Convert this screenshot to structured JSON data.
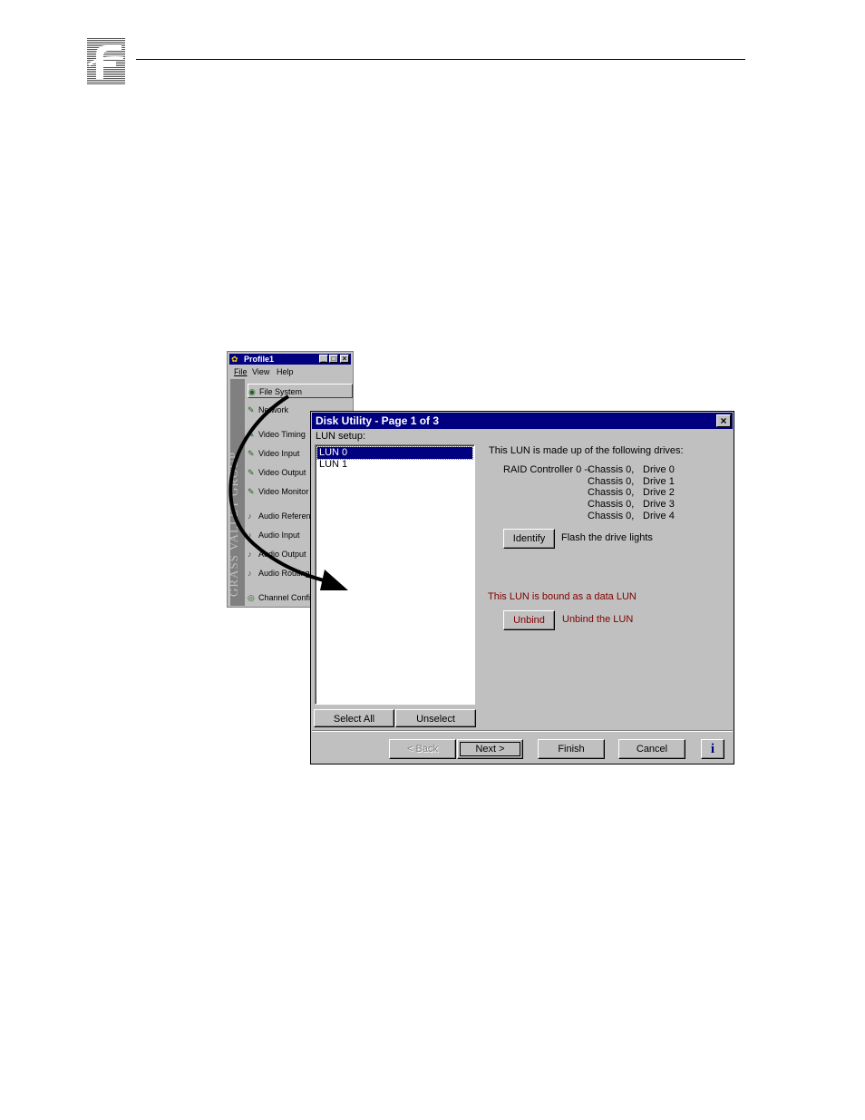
{
  "profile_window": {
    "title": "Profile1",
    "menu": [
      "File",
      "View",
      "Help"
    ],
    "sidebar_brand": "GRASS VALLEY GROUP",
    "nav_items": [
      "File System",
      "Network",
      "Video Timing",
      "Video Input",
      "Video Output",
      "Video Monitor",
      "Audio Reference",
      "Audio Input",
      "Audio Output",
      "Audio Routing",
      "Channel Config"
    ]
  },
  "dialog": {
    "title": "Disk Utility - Page 1 of 3",
    "lun_setup_label": "LUN setup:",
    "luns": [
      "LUN 0",
      "LUN 1"
    ],
    "select_all": "Select All",
    "unselect": "Unselect",
    "made_up_text": "This LUN is made up of the following drives:",
    "controller": "RAID Controller 0 --",
    "drives": [
      {
        "chassis": "Chassis 0,",
        "drive": "Drive 0"
      },
      {
        "chassis": "Chassis 0,",
        "drive": "Drive 1"
      },
      {
        "chassis": "Chassis 0,",
        "drive": "Drive 2"
      },
      {
        "chassis": "Chassis 0,",
        "drive": "Drive 3"
      },
      {
        "chassis": "Chassis 0,",
        "drive": "Drive 4"
      }
    ],
    "identify_label": "Identify",
    "identify_desc": "Flash the drive lights",
    "bound_text": "This LUN is bound as a data LUN",
    "unbind_label": "Unbind",
    "unbind_desc": "Unbind the LUN",
    "back": "< Back",
    "next": "Next >",
    "finish": "Finish",
    "cancel": "Cancel",
    "info": "i",
    "close_glyph": "×"
  },
  "colors": {
    "titlebar": "#000080",
    "face": "#c0c0c0",
    "maroon": "#800000"
  }
}
